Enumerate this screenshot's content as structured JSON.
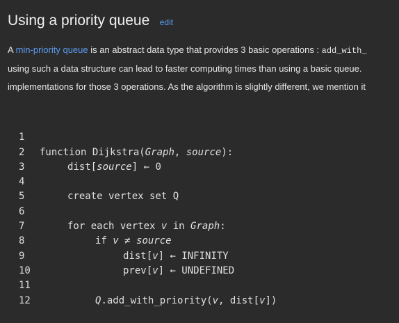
{
  "heading": {
    "title": "Using a priority queue",
    "edit_label": "edit"
  },
  "paragraph": {
    "line1_prefix": "A ",
    "line1_link": "min-priority queue",
    "line1_middle": " is an abstract data type that provides 3 basic operations : ",
    "line1_code": "add_with_",
    "line2": "using such a data structure can lead to faster computing times than using a basic queue.",
    "line3": "implementations for those 3 operations. As the algorithm is slightly different, we mention it"
  },
  "code": {
    "line_numbers": [
      "1",
      "2",
      "3",
      "4",
      "5",
      "6",
      "7",
      "8",
      "9",
      "10",
      "11",
      "12"
    ],
    "l1_kw": "function",
    "l1_name": " Dijkstra(",
    "l1_arg1": "Graph",
    "l1_comma": ", ",
    "l1_arg2": "source",
    "l1_end": "):",
    "l2_a": "dist[",
    "l2_b": "source",
    "l2_c": "] ← 0",
    "l4": "create vertex set Q",
    "l6_a": "for each",
    "l6_b": " vertex ",
    "l6_c": "v",
    "l6_d": " in ",
    "l6_e": "Graph",
    "l6_f": ":",
    "l7_a": "if",
    "l7_b": " v",
    "l7_c": " ≠ ",
    "l7_d": "source",
    "l8_a": "dist[",
    "l8_b": "v",
    "l8_c": "] ← INFINITY",
    "l9_a": "prev[",
    "l9_b": "v",
    "l9_c": "] ← UNDEFINED",
    "l11_a": "Q",
    "l11_b": ".add_with_priority(",
    "l11_c": "v",
    "l11_d": ", dist[",
    "l11_e": "v",
    "l11_f": "])"
  }
}
